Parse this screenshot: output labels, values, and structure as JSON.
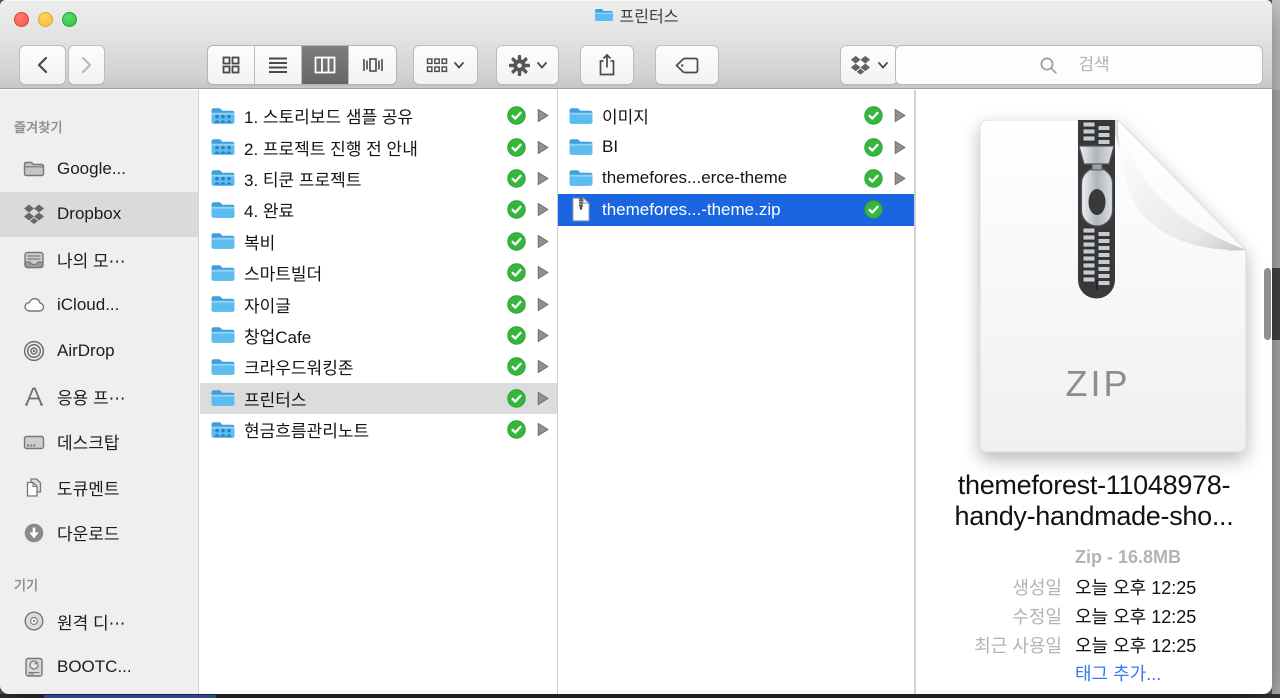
{
  "window": {
    "title": "프린터스"
  },
  "toolbar": {
    "back_tooltip": "back",
    "forward_tooltip": "forward",
    "views": [
      "icon-view",
      "list-view",
      "column-view",
      "coverflow-view"
    ],
    "selected_view": "column-view",
    "search_placeholder": "검색"
  },
  "sidebar": {
    "sections": [
      {
        "header": "즐겨찾기",
        "items": [
          {
            "label": "Google...",
            "icon": "folder",
            "selected": false
          },
          {
            "label": "Dropbox",
            "icon": "dropbox",
            "selected": true
          },
          {
            "label": "나의 모⋯",
            "icon": "tray",
            "selected": false
          },
          {
            "label": "iCloud...",
            "icon": "cloud",
            "selected": false
          },
          {
            "label": "AirDrop",
            "icon": "airdrop",
            "selected": false
          },
          {
            "label": "응용 프⋯",
            "icon": "applications",
            "selected": false
          },
          {
            "label": "데스크탑",
            "icon": "desktop",
            "selected": false
          },
          {
            "label": "도큐멘트",
            "icon": "documents",
            "selected": false
          },
          {
            "label": "다운로드",
            "icon": "downloads",
            "selected": false
          }
        ]
      },
      {
        "header": "기기",
        "items": [
          {
            "label": "원격 디⋯",
            "icon": "disc",
            "selected": false
          },
          {
            "label": "BOOTC...",
            "icon": "harddrive",
            "selected": false
          }
        ]
      }
    ]
  },
  "columns": [
    {
      "name": "column-1",
      "items": [
        {
          "label": "1. 스토리보드 샘플 공유",
          "icon": "shared-folder",
          "badge": "synced",
          "chevron": true,
          "selected": ""
        },
        {
          "label": "2. 프로젝트 진행 전 안내",
          "icon": "shared-folder",
          "badge": "synced",
          "chevron": true,
          "selected": ""
        },
        {
          "label": "3. 티쿤 프로젝트",
          "icon": "shared-folder",
          "badge": "synced",
          "chevron": true,
          "selected": ""
        },
        {
          "label": "4. 완료",
          "icon": "folder",
          "badge": "synced",
          "chevron": true,
          "selected": ""
        },
        {
          "label": "복비",
          "icon": "folder",
          "badge": "synced",
          "chevron": true,
          "selected": ""
        },
        {
          "label": "스마트빌더",
          "icon": "folder",
          "badge": "synced",
          "chevron": true,
          "selected": ""
        },
        {
          "label": "자이글",
          "icon": "folder",
          "badge": "synced",
          "chevron": true,
          "selected": ""
        },
        {
          "label": "창업Cafe",
          "icon": "folder",
          "badge": "synced",
          "chevron": true,
          "selected": ""
        },
        {
          "label": "크라우드워킹존",
          "icon": "folder",
          "badge": "synced",
          "chevron": true,
          "selected": ""
        },
        {
          "label": "프린터스",
          "icon": "folder",
          "badge": "synced",
          "chevron": true,
          "selected": "gray"
        },
        {
          "label": "현금흐름관리노트",
          "icon": "shared-folder",
          "badge": "synced",
          "chevron": true,
          "selected": ""
        }
      ]
    },
    {
      "name": "column-2",
      "items": [
        {
          "label": "이미지",
          "icon": "folder",
          "badge": "synced",
          "chevron": true,
          "selected": ""
        },
        {
          "label": "BI",
          "icon": "folder",
          "badge": "synced",
          "chevron": true,
          "selected": ""
        },
        {
          "label": "themefores...erce-theme",
          "icon": "folder",
          "badge": "synced",
          "chevron": true,
          "selected": ""
        },
        {
          "label": "themefores...-theme.zip",
          "icon": "zip-file",
          "badge": "synced",
          "chevron": false,
          "selected": "blue"
        }
      ]
    }
  ],
  "preview": {
    "file_type_label": "ZIP",
    "name_line1": "themeforest-11048978-",
    "name_line2": "handy-handmade-sho...",
    "kind_size": "Zip - 16.8MB",
    "meta": [
      {
        "label": "생성일",
        "value": "오늘 오후 12:25"
      },
      {
        "label": "수정일",
        "value": "오늘 오후 12:25"
      },
      {
        "label": "최근 사용일",
        "value": "오늘 오후 12:25"
      }
    ],
    "add_tags_label": "태그 추가..."
  },
  "colors": {
    "selection_blue": "#1a66e0",
    "selection_gray": "#dcdcdc",
    "badge_green": "#35b63c",
    "link_blue": "#3478f7",
    "folder_blue": "#5cbcf0"
  }
}
